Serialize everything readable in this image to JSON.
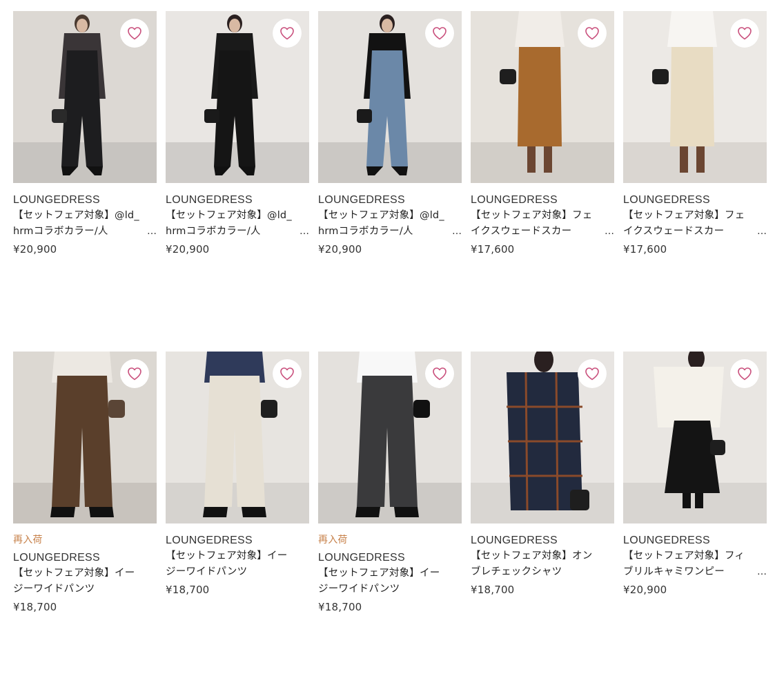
{
  "products": [
    {
      "tag": "",
      "brand": "LOUNGEDRESS",
      "name": "【セットフェア対象】@ld_hrmコラボカラー/人",
      "more": "…",
      "price": "¥20,900",
      "photo": {
        "bg": "#dcd8d3",
        "floor": "#c7c4c0",
        "top": "#3a3537",
        "bottom": "#1d1d1f",
        "skin": "#d8b9a3",
        "hair": "#4a3a30",
        "style": "overall",
        "bag": "#2a2a2a"
      }
    },
    {
      "tag": "",
      "brand": "LOUNGEDRESS",
      "name": "【セットフェア対象】@ld_hrmコラボカラー/人",
      "more": "…",
      "price": "¥20,900",
      "photo": {
        "bg": "#e9e6e3",
        "floor": "#cfccc9",
        "top": "#1a1a1a",
        "bottom": "#151515",
        "skin": "#d8b9a3",
        "hair": "#2a2020",
        "style": "overall",
        "bag": "#1a1a1a"
      }
    },
    {
      "tag": "",
      "brand": "LOUNGEDRESS",
      "name": "【セットフェア対象】@ld_hrmコラボカラー/人",
      "more": "…",
      "price": "¥20,900",
      "photo": {
        "bg": "#e4e1dd",
        "floor": "#cbc8c4",
        "top": "#121212",
        "bottom": "#6b88a8",
        "skin": "#d8b9a3",
        "hair": "#2a2020",
        "style": "overall",
        "bag": "#1a1a1a"
      }
    },
    {
      "tag": "",
      "brand": "LOUNGEDRESS",
      "name": "【セットフェア対象】フェイクスウェードスカー",
      "more": "…",
      "price": "¥17,600",
      "photo": {
        "bg": "#e6e2dc",
        "floor": "#d2cec8",
        "top": "#f1ede8",
        "bottom": "#a86a2e",
        "skin": "#d8b9a3",
        "hair": "#2a2020",
        "style": "skirt",
        "bag": "#1e1e1e"
      }
    },
    {
      "tag": "",
      "brand": "LOUNGEDRESS",
      "name": "【セットフェア対象】フェイクスウェードスカー",
      "more": "…",
      "price": "¥17,600",
      "photo": {
        "bg": "#ece9e5",
        "floor": "#dad6d1",
        "top": "#f7f5f2",
        "bottom": "#e8dcc3",
        "skin": "#d8b9a3",
        "hair": "#2a2020",
        "style": "skirt",
        "bag": "#1e1e1e"
      }
    },
    {
      "tag": "再入荷",
      "brand": "LOUNGEDRESS",
      "name": "【セットフェア対象】イージーワイドパンツ",
      "more": "",
      "price": "¥18,700",
      "photo": {
        "bg": "#dcd8d2",
        "floor": "#c8c3bd",
        "top": "#ece8e2",
        "bottom": "#5a3f2b",
        "skin": "#d8b9a3",
        "hair": "#2a2020",
        "style": "pants",
        "bag": "#5a4536"
      }
    },
    {
      "tag": "",
      "brand": "LOUNGEDRESS",
      "name": "【セットフェア対象】イージーワイドパンツ",
      "more": "",
      "price": "¥18,700",
      "photo": {
        "bg": "#e7e4e0",
        "floor": "#d6d3cf",
        "top": "#2f3a5a",
        "bottom": "#e6e0d4",
        "skin": "#d8b9a3",
        "hair": "#2a2020",
        "style": "pants",
        "bag": "#1e1e1e"
      }
    },
    {
      "tag": "再入荷",
      "brand": "LOUNGEDRESS",
      "name": "【セットフェア対象】イージーワイドパンツ",
      "more": "",
      "price": "¥18,700",
      "photo": {
        "bg": "#e4e1dd",
        "floor": "#cdcac6",
        "top": "#f8f8f8",
        "bottom": "#3a3a3c",
        "skin": "#d8b9a3",
        "hair": "#2a2020",
        "style": "pants",
        "bag": "#111111"
      }
    },
    {
      "tag": "",
      "brand": "LOUNGEDRESS",
      "name": "【セットフェア対象】オンブレチェックシャツ",
      "more": "",
      "price": "¥18,700",
      "photo": {
        "bg": "#e8e5e2",
        "floor": "#d9d6d2",
        "top": "#222a3e",
        "bottom": "#1a1a1a",
        "skin": "#d8b9a3",
        "hair": "#2a2020",
        "style": "shirt",
        "bag": "#1e1e1e"
      }
    },
    {
      "tag": "",
      "brand": "LOUNGEDRESS",
      "name": "【セットフェア対象】フィブリルキャミワンピー",
      "more": "…",
      "price": "¥20,900",
      "photo": {
        "bg": "#e9e6e2",
        "floor": "#d8d5d1",
        "top": "#f4f1ea",
        "bottom": "#141414",
        "skin": "#d8b9a3",
        "hair": "#2a2020",
        "style": "dress",
        "bag": "#1e1e1e"
      }
    }
  ],
  "accent_color": "#c94f7c",
  "restock_color": "#c7814a",
  "icons": {
    "favorite": "heart-outline-icon"
  }
}
